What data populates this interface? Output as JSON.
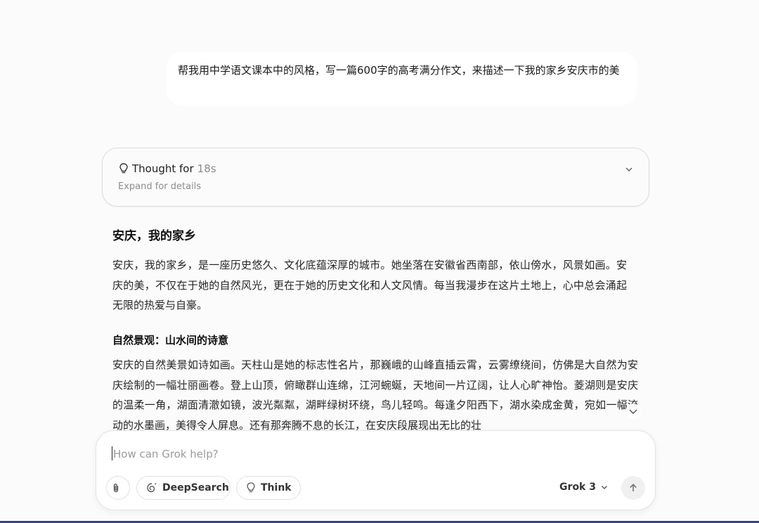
{
  "user_message": {
    "text": "帮我用中学语文课本中的风格，写一篇600字的高考满分作文，来描述一下我的家乡安庆市的美"
  },
  "thought": {
    "label": "Thought for",
    "duration": "18s",
    "sub": "Expand for details"
  },
  "answer": {
    "title": "安庆，我的家乡",
    "para1": "安庆，我的家乡，是一座历史悠久、文化底蕴深厚的城市。她坐落在安徽省西南部，依山傍水，风景如画。安庆的美，不仅在于她的自然风光，更在于她的历史文化和人文风情。每当我漫步在这片土地上，心中总会涌起无限的热爱与自豪。",
    "section_title": "自然景观：山水间的诗意",
    "para2": "安庆的自然美景如诗如画。天柱山是她的标志性名片，那巍峨的山峰直插云霄，云雾缭绕间，仿佛是大自然为安庆绘制的一幅壮丽画卷。登上山顶，俯瞰群山连绵，江河蜿蜒，天地间一片辽阔，让人心旷神怡。菱湖则是安庆的温柔一角，湖面清澈如镜，波光粼粼，湖畔绿树环绕，鸟儿轻鸣。每逢夕阳西下，湖水染成金黄，宛如一幅流动的水墨画，美得令人屏息。还有那奔腾不息的长江，在安庆段展现出无比的壮"
  },
  "composer": {
    "placeholder": "How can Grok help?",
    "deepsearch_label": "DeepSearch",
    "think_label": "Think",
    "model_label": "Grok 3"
  },
  "icons": {
    "thought": "lightbulb-icon",
    "expand": "chevron-down-icon",
    "attach": "paperclip-icon",
    "deepsearch": "deepsearch-icon",
    "think": "lightbulb-icon",
    "model": "chevron-down-icon",
    "send": "arrow-up-icon",
    "scroll": "chevron-down-icon"
  }
}
